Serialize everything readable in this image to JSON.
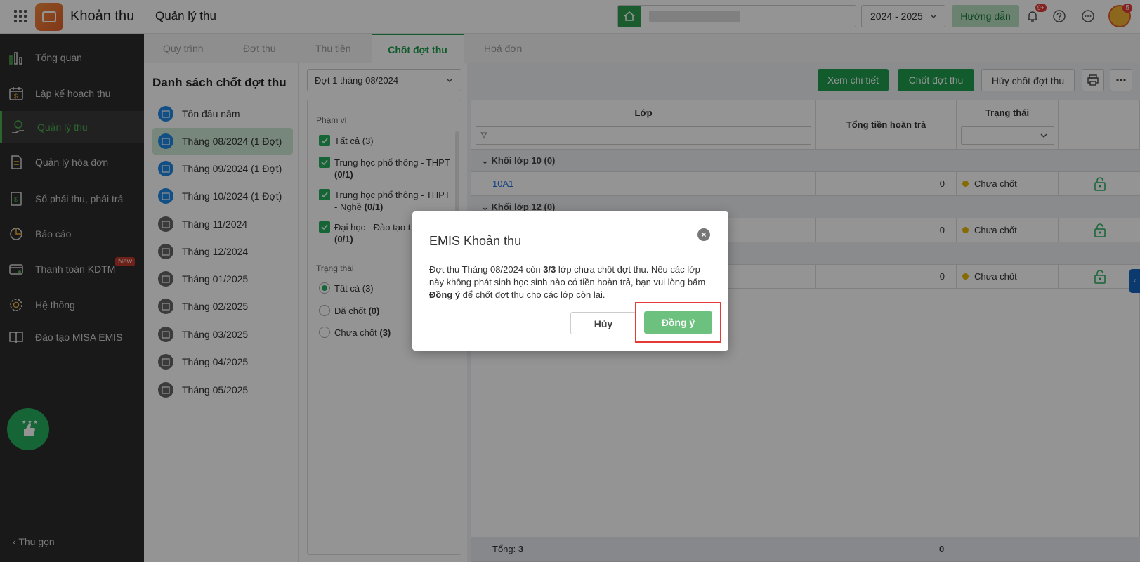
{
  "topbar": {
    "app_name": "Khoản thu",
    "page_title": "Quản lý thu",
    "year": "2024 - 2025",
    "guide_label": "Hướng dẫn",
    "notification_badge": "9+",
    "avatar_badge": "5"
  },
  "sidebar": {
    "items": [
      {
        "label": "Tổng quan"
      },
      {
        "label": "Lập kế hoạch thu"
      },
      {
        "label": "Quản lý thu"
      },
      {
        "label": "Quản lý hóa đơn"
      },
      {
        "label": "Sổ phải thu, phải trả"
      },
      {
        "label": "Báo cáo"
      },
      {
        "label": "Thanh toán KDTM"
      },
      {
        "label": "Hệ thống"
      },
      {
        "label": "Đào tạo MISA EMIS"
      }
    ],
    "new_badge": "New",
    "collapse_label": "Thu gọn"
  },
  "tabs": [
    {
      "label": "Quy trình"
    },
    {
      "label": "Đợt thu"
    },
    {
      "label": "Thu tiền"
    },
    {
      "label": "Chốt đợt thu"
    },
    {
      "label": "Hoá đơn"
    }
  ],
  "list": {
    "title": "Danh sách chốt đợt thu",
    "items": [
      {
        "label": "Tồn đầu năm"
      },
      {
        "label": "Tháng 08/2024 (1 Đợt)"
      },
      {
        "label": "Tháng 09/2024 (1 Đợt)"
      },
      {
        "label": "Tháng 10/2024 (1 Đợt)"
      },
      {
        "label": "Tháng 11/2024"
      },
      {
        "label": "Tháng 12/2024"
      },
      {
        "label": "Tháng 01/2025"
      },
      {
        "label": "Tháng 02/2025"
      },
      {
        "label": "Tháng 03/2025"
      },
      {
        "label": "Tháng 04/2025"
      },
      {
        "label": "Tháng 05/2025"
      }
    ]
  },
  "filter": {
    "dot_select": "Đợt 1 tháng 08/2024",
    "scope_label": "Phạm vi",
    "scope_items": [
      {
        "text": "Tất cả (3)"
      },
      {
        "text": "Trung học phổ thông - THPT",
        "count": "(0/1)"
      },
      {
        "text": "Trung học phổ thông - THPT - Nghề",
        "count": "(0/1)"
      },
      {
        "text": "Đại học - Đào tạo t",
        "count": "(0/1)"
      }
    ],
    "status_label": "Trạng thái",
    "status_items": [
      {
        "text": "Tất cả (3)",
        "count": ""
      },
      {
        "text": "Đã chốt",
        "count": "(0)"
      },
      {
        "text": "Chưa chốt",
        "count": "(3)"
      }
    ]
  },
  "toolbar": {
    "view_detail": "Xem chi tiết",
    "close_batch": "Chốt đợt thu",
    "cancel_close": "Hủy chốt đợt thu"
  },
  "table": {
    "headers": {
      "class": "Lớp",
      "refund": "Tổng tiền hoàn trả",
      "status": "Trạng thái"
    },
    "groups": [
      {
        "label": "Khối lớp 10 (0)"
      },
      {
        "label": "Khối lớp 12 (0)"
      }
    ],
    "rows": [
      {
        "class": "10A1",
        "refund": "0",
        "status": "Chưa chốt"
      },
      {
        "class": "",
        "refund": "0",
        "status": "Chưa chốt"
      },
      {
        "class": "",
        "refund": "0",
        "status": "Chưa chốt"
      }
    ],
    "footer": {
      "label": "Tổng:",
      "count": "3",
      "total": "0"
    }
  },
  "modal": {
    "title": "EMIS Khoản thu",
    "body_1": "Đợt thu Tháng 08/2024 còn ",
    "body_bold_1": "3/3",
    "body_2": " lớp chưa chốt đợt thu. Nếu các lớp này không phát sinh học sinh nào có tiền hoàn trả, bạn vui lòng bấm ",
    "body_bold_2": "Đồng ý",
    "body_3": " để chốt đợt thu cho các lớp còn lại.",
    "cancel_label": "Hủy",
    "ok_label": "Đồng ý"
  },
  "colors": {
    "brand_green": "#1e9e4e",
    "sidebar_bg": "#2c2c2c",
    "status_pending": "#e6b800"
  }
}
